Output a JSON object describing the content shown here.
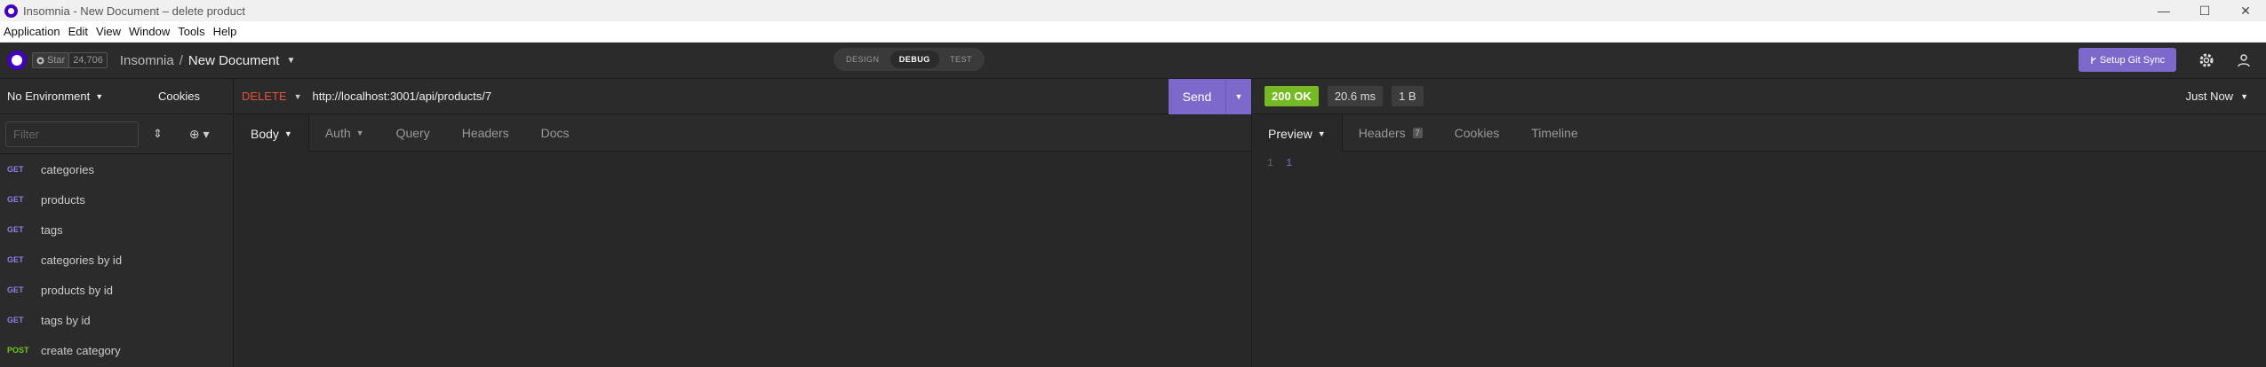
{
  "window": {
    "title": "Insomnia - New Document – delete product",
    "controls": [
      "—",
      "☐",
      "✕"
    ]
  },
  "menu": [
    "Application",
    "Edit",
    "View",
    "Window",
    "Tools",
    "Help"
  ],
  "header": {
    "star_label": "Star",
    "star_count": "24,706",
    "breadcrumb_root": "Insomnia",
    "breadcrumb_sep": "/",
    "breadcrumb_current": "New Document",
    "modes": [
      "DESIGN",
      "DEBUG",
      "TEST"
    ],
    "active_mode": "DEBUG",
    "gitsync_label": "Setup Git Sync"
  },
  "sidebar": {
    "environment": "No Environment",
    "cookies_label": "Cookies",
    "filter_placeholder": "Filter",
    "requests": [
      {
        "method": "GET",
        "name": "categories"
      },
      {
        "method": "GET",
        "name": "products"
      },
      {
        "method": "GET",
        "name": "tags"
      },
      {
        "method": "GET",
        "name": "categories by id"
      },
      {
        "method": "GET",
        "name": "products by id"
      },
      {
        "method": "GET",
        "name": "tags by id"
      },
      {
        "method": "POST",
        "name": "create category"
      }
    ]
  },
  "request": {
    "method": "DELETE",
    "url": "http://localhost:3001/api/products/7",
    "send_label": "Send",
    "tabs": [
      "Body",
      "Auth",
      "Query",
      "Headers",
      "Docs"
    ]
  },
  "response": {
    "status": "200 OK",
    "time": "20.6 ms",
    "size": "1 B",
    "history_label": "Just Now",
    "tabs": [
      "Preview",
      "Headers",
      "Cookies",
      "Timeline"
    ],
    "headers_count": "7",
    "lines": [
      {
        "num": "1",
        "text": "1"
      }
    ]
  },
  "colors": {
    "accent": "#7d69cb",
    "delete": "#e6513e",
    "get": "#8f7ee4",
    "post": "#74c41b",
    "ok": "#75ba24"
  }
}
